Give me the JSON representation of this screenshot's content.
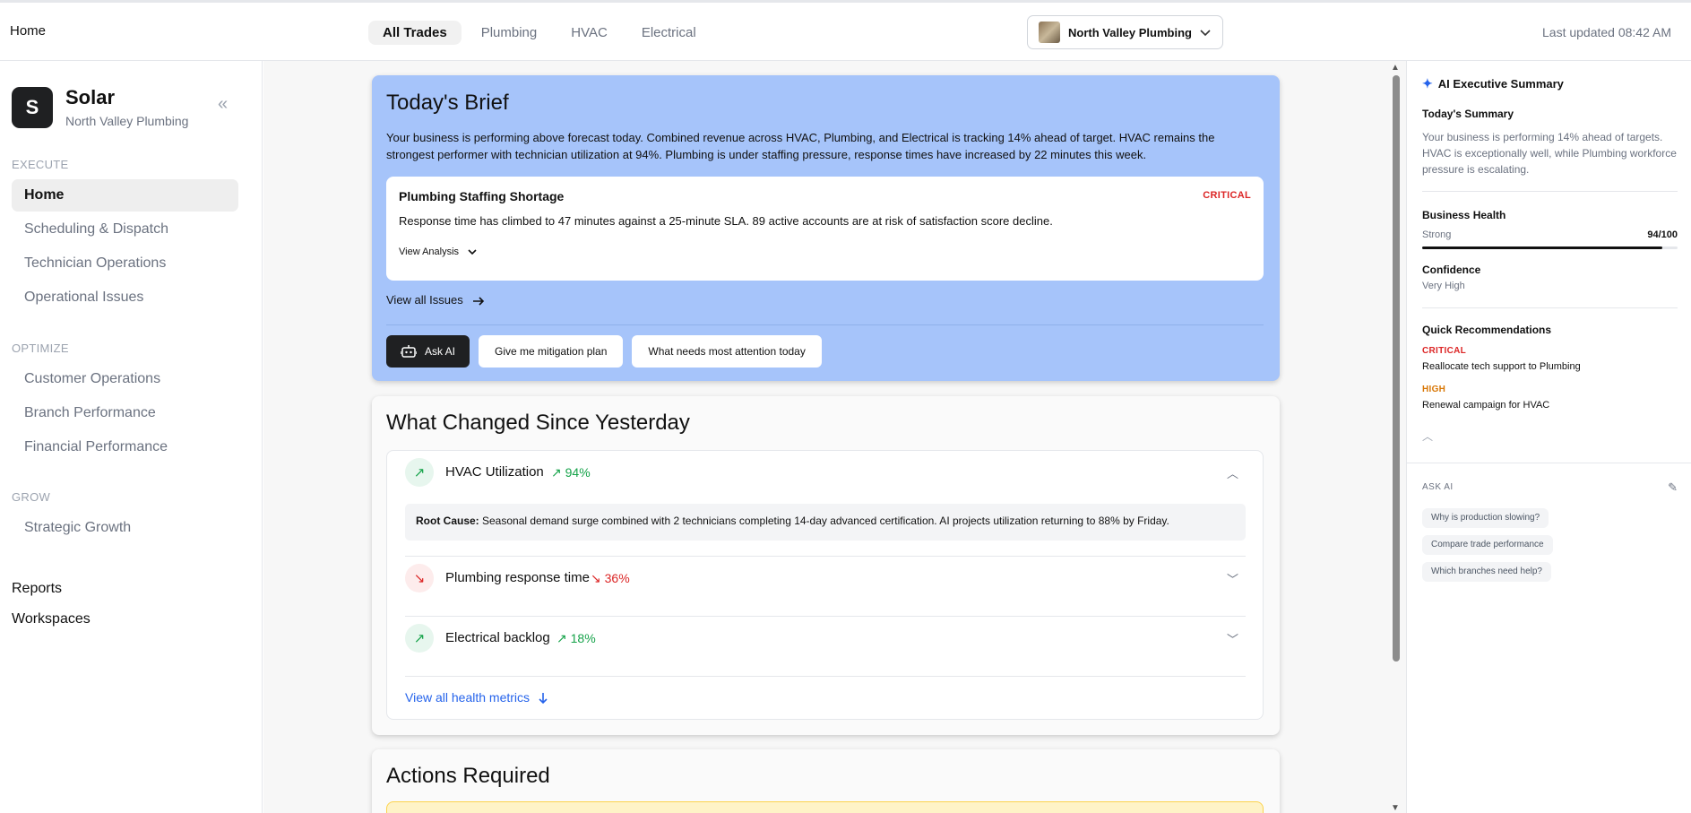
{
  "header": {
    "breadcrumb": "Home",
    "tabs": [
      {
        "label": "All Trades",
        "active": true
      },
      {
        "label": "Plumbing",
        "active": false
      },
      {
        "label": "HVAC",
        "active": false
      },
      {
        "label": "Electrical",
        "active": false
      }
    ],
    "org_selector": "North Valley Plumbing",
    "last_updated": "Last updated 08:42 AM"
  },
  "sidebar": {
    "brand_initial": "S",
    "brand_name": "Solar",
    "brand_sub": "North Valley Plumbing",
    "sections": {
      "execute": "EXECUTE",
      "optimize": "OPTIMIZE",
      "grow": "GROW"
    },
    "execute_items": [
      "Home",
      "Scheduling & Dispatch",
      "Technician Operations",
      "Operational Issues"
    ],
    "optimize_items": [
      "Customer Operations",
      "Branch Performance",
      "Financial Performance"
    ],
    "grow_items": [
      "Strategic Growth"
    ],
    "bottom_items": [
      "Reports",
      "Workspaces"
    ],
    "active_item": "Home"
  },
  "brief": {
    "title": "Today's Brief",
    "text": "Your business is performing above forecast today. Combined revenue across HVAC, Plumbing, and Electrical is tracking 14% ahead of target. HVAC remains the strongest performer with technician utilization at 94%. Plumbing is under staffing pressure, response times have increased by 22 minutes this week.",
    "alert": {
      "title": "Plumbing Staffing Shortage",
      "badge": "CRITICAL",
      "body": "Response time has climbed to 47 minutes against a 25-minute SLA. 89 active accounts are at risk of satisfaction score decline.",
      "view_analysis": "View Analysis"
    },
    "view_all_issues": "View all Issues",
    "buttons": {
      "ask_ai": "Ask AI",
      "mitigation": "Give me mitigation plan",
      "attention": "What needs most attention today"
    }
  },
  "changes": {
    "title": "What Changed Since Yesterday",
    "rows": [
      {
        "label": "HVAC Utilization",
        "delta": "↗ 94%",
        "direction": "up"
      },
      {
        "label": "Plumbing response time",
        "delta": "↘ 36%",
        "direction": "down"
      },
      {
        "label": "Electrical backlog",
        "delta": "↗ 18%",
        "direction": "up"
      }
    ],
    "root_cause_label": "Root Cause:",
    "root_cause_text": " Seasonal demand surge combined with 2 technicians completing 14-day advanced certification. AI projects utilization returning to 88% by Friday.",
    "view_all": "View all health metrics"
  },
  "actions": {
    "title": "Actions Required"
  },
  "summary": {
    "header": "AI Executive Summary",
    "today_title": "Today's Summary",
    "today_text": "Your business is performing 14% ahead of targets. HVAC is exceptionally well, while Plumbing workforce pressure is escalating.",
    "health_title": "Business Health",
    "health_label": "Strong",
    "health_value": "94/100",
    "health_fraction": 0.94,
    "confidence_title": "Confidence",
    "confidence_value": "Very High",
    "recs_title": "Quick Recommendations",
    "recs": [
      {
        "level": "CRITICAL",
        "text": "Reallocate tech support to Plumbing",
        "color": "#dc2626"
      },
      {
        "level": "HIGH",
        "text": "Renewal campaign for HVAC",
        "color": "#d97706"
      }
    ],
    "ask_label": "ASK AI",
    "chips": [
      "Why is production slowing?",
      "Compare trade performance",
      "Which branches need help?"
    ]
  },
  "icons": {
    "collapse": "chevrons-left-icon",
    "dropdown": "chevron-down-icon",
    "arrow_right": "arrow-right-icon",
    "bot": "robot-icon",
    "sparkle": "sparkle-icon",
    "pencil": "pencil-icon"
  }
}
